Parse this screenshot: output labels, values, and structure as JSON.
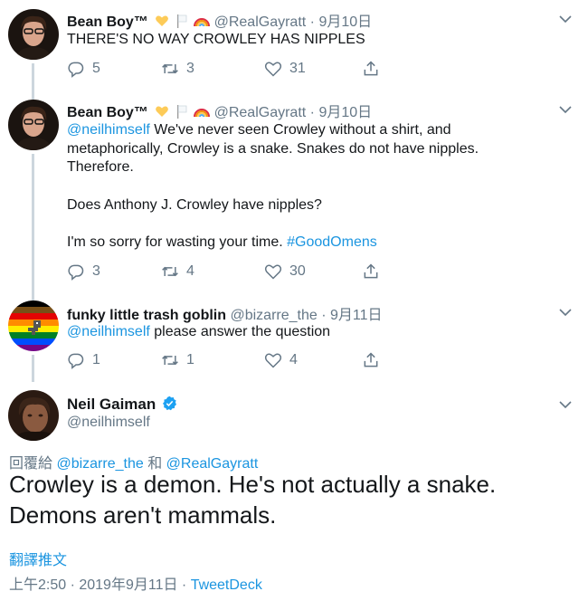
{
  "tweets": [
    {
      "name": "Bean Boy™",
      "handle": "@RealGayratt",
      "separator": "·",
      "date": "9月10日",
      "text": "THERE'S NO WAY CROWLEY HAS NIPPLES",
      "replies": "5",
      "retweets": "3",
      "likes": "31"
    },
    {
      "name": "Bean Boy™",
      "handle": "@RealGayratt",
      "separator": "·",
      "date": "9月10日",
      "mention": "@neilhimself",
      "line1_rest": " We've never seen Crowley without a shirt, and metaphorically, Crowley is a snake. Snakes do not have nipples. Therefore.",
      "line2": "Does Anthony J. Crowley have nipples?",
      "line3_pre": "I'm so sorry for wasting your time. ",
      "hashtag": "#GoodOmens",
      "replies": "3",
      "retweets": "4",
      "likes": "30"
    },
    {
      "name": "funky little trash goblin",
      "handle": "@bizarre_the",
      "separator": "·",
      "date": "9月11日",
      "mention": "@neilhimself",
      "text_rest": " please answer the question",
      "replies": "1",
      "retweets": "1",
      "likes": "4"
    }
  ],
  "main_tweet": {
    "name": "Neil Gaiman",
    "handle": "@neilhimself",
    "replying_prefix": "回覆給 ",
    "replying_user1": "@bizarre_the",
    "replying_and": " 和 ",
    "replying_user2": "@RealGayratt",
    "text": "Crowley is a demon. He's not actually a snake. Demons aren't mammals.",
    "translate": "翻譯推文",
    "time": "上午2:50 · 2019年9月11日 · ",
    "client": "TweetDeck"
  },
  "colors": {
    "link": "#1b95e0",
    "muted": "#657786",
    "text": "#14171a",
    "verified": "#1da1f2"
  },
  "icons": [
    "reply-icon",
    "retweet-icon",
    "like-icon",
    "share-icon",
    "chevron-down-icon",
    "verified-icon",
    "yellow-heart-emoji",
    "white-flag-emoji",
    "rainbow-emoji"
  ]
}
